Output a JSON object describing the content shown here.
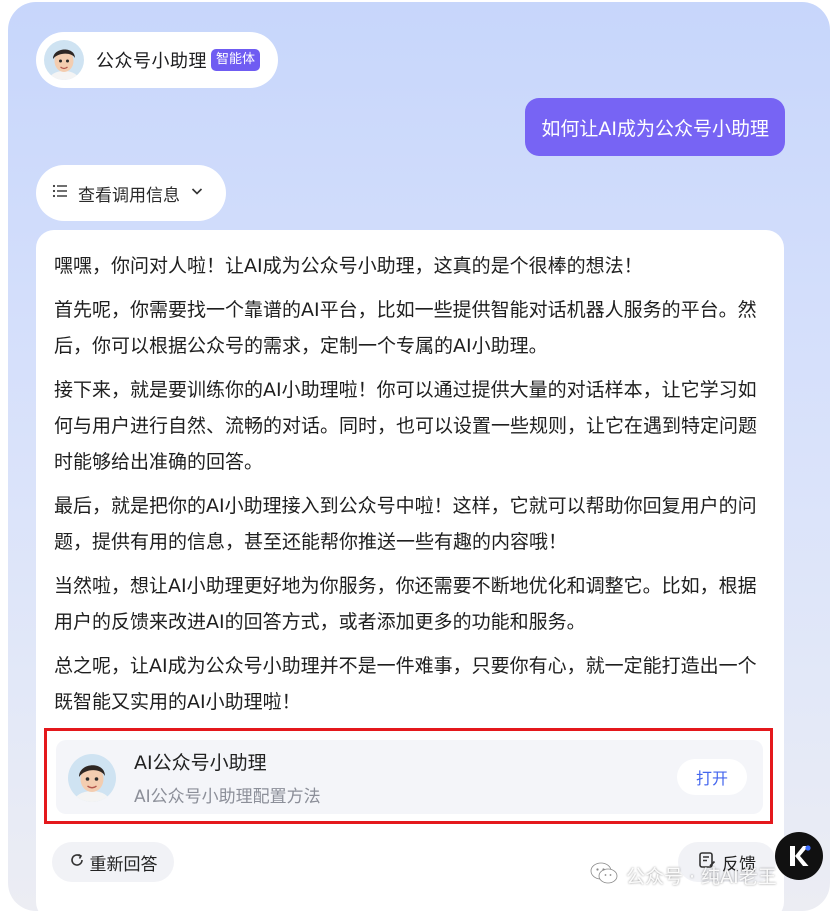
{
  "header": {
    "agent_name": "公众号小助理",
    "agent_badge": "智能体"
  },
  "user_message": "如何让AI成为公众号小助理",
  "call_info": {
    "label": "查看调用信息"
  },
  "answer": {
    "paragraphs": [
      "嘿嘿，你问对人啦！让AI成为公众号小助理，这真的是个很棒的想法！",
      "首先呢，你需要找一个靠谱的AI平台，比如一些提供智能对话机器人服务的平台。然后，你可以根据公众号的需求，定制一个专属的AI小助理。",
      "接下来，就是要训练你的AI小助理啦！你可以通过提供大量的对话样本，让它学习如何与用户进行自然、流畅的对话。同时，也可以设置一些规则，让它在遇到特定问题时能够给出准确的回答。",
      "最后，就是把你的AI小助理接入到公众号中啦！这样，它就可以帮助你回复用户的问题，提供有用的信息，甚至还能帮你推送一些有趣的内容哦！",
      "当然啦，想让AI小助理更好地为你服务，你还需要不断地优化和调整它。比如，根据用户的反馈来改进AI的回答方式，或者添加更多的功能和服务。",
      "总之呢，让AI成为公众号小助理并不是一件难事，只要你有心，就一定能打造出一个既智能又实用的AI小助理啦！"
    ]
  },
  "app_card": {
    "title": "AI公众号小助理",
    "subtitle": "AI公众号小助理配置方法",
    "open_label": "打开"
  },
  "actions": {
    "regenerate_label": "重新回答",
    "feedback_label": "反馈"
  },
  "watermark": {
    "text": "公众号 · 纯AI老王"
  },
  "colors": {
    "accent": "#7764f4",
    "badge": "#6f5cf2",
    "highlight_border": "#e4181c",
    "link": "#4466ee"
  },
  "icons": [
    "avatar",
    "list-icon",
    "chevron-down-icon",
    "refresh-icon",
    "feedback-icon",
    "wechat-icon",
    "k-logo"
  ]
}
